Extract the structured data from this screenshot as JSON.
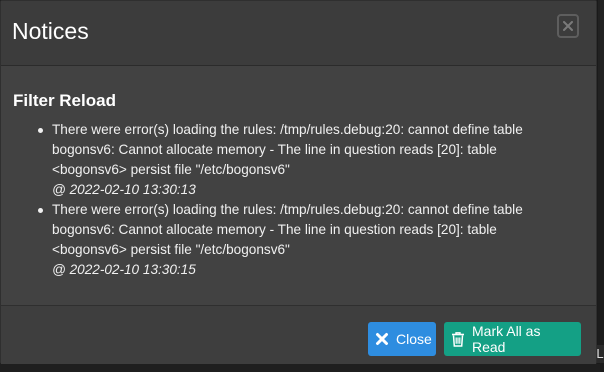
{
  "modal": {
    "title": "Notices",
    "section_title": "Filter Reload",
    "notices": [
      {
        "message": "There were error(s) loading the rules: /tmp/rules.debug:20: cannot define table bogonsv6: Cannot allocate memory - The line in question reads [20]: table <bogonsv6> persist file \"/etc/bogonsv6\"",
        "timestamp": "@ 2022-02-10 13:30:13"
      },
      {
        "message": "There were error(s) loading the rules: /tmp/rules.debug:20: cannot define table bogonsv6: Cannot allocate memory - The line in question reads [20]: table <bogonsv6> persist file \"/etc/bogonsv6\"",
        "timestamp": "@ 2022-02-10 13:30:15"
      }
    ],
    "buttons": {
      "close_label": "Close",
      "mark_all_label": "Mark All as Read"
    }
  },
  "background": {
    "edge_letter": "L"
  },
  "icons": {
    "dismiss": "close-x-icon",
    "close": "times-icon",
    "mark_all": "trash-icon"
  },
  "colors": {
    "close_button": "#2e8de0",
    "mark_all_button": "#14a085",
    "modal_background": "#424242"
  }
}
